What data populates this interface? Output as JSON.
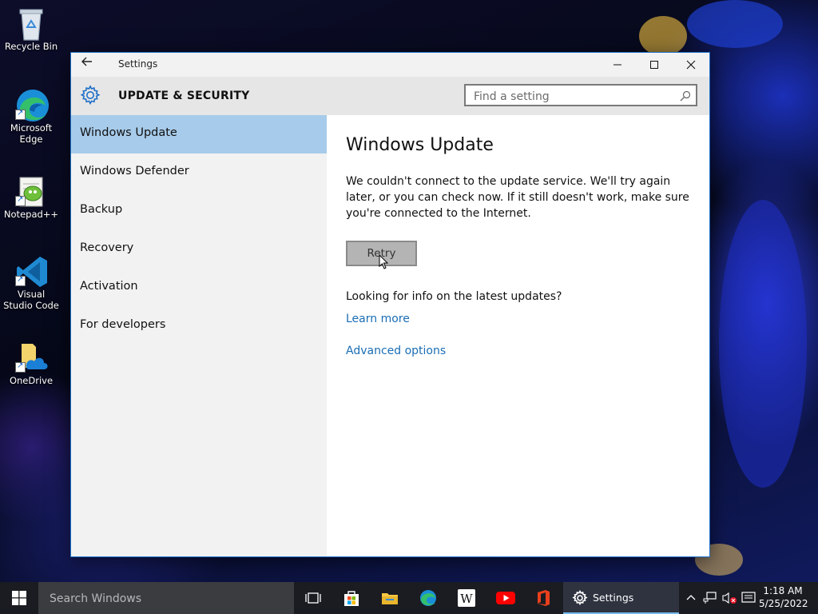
{
  "desktop": {
    "icons": [
      {
        "label": "Recycle Bin"
      },
      {
        "label": "Microsoft Edge"
      },
      {
        "label": "Notepad++"
      },
      {
        "label": "Visual Studio Code"
      },
      {
        "label": "OneDrive"
      }
    ]
  },
  "window": {
    "title": "Settings",
    "back_icon": "back-arrow-icon",
    "controls": [
      "minimize",
      "maximize",
      "close"
    ]
  },
  "header": {
    "title": "UPDATE & SECURITY",
    "search_placeholder": "Find a setting"
  },
  "sidebar": {
    "items": [
      {
        "label": "Windows Update",
        "active": true
      },
      {
        "label": "Windows Defender",
        "active": false
      },
      {
        "label": "Backup",
        "active": false
      },
      {
        "label": "Recovery",
        "active": false
      },
      {
        "label": "Activation",
        "active": false
      },
      {
        "label": "For developers",
        "active": false
      }
    ]
  },
  "main": {
    "title": "Windows Update",
    "message": "We couldn't connect to the update service. We'll try again later, or you can check now. If it still doesn't work, make sure you're connected to the Internet.",
    "retry_label": "Retry",
    "info_question": "Looking for info on the latest updates?",
    "learn_more": "Learn more",
    "advanced_options": "Advanced options"
  },
  "taskbar": {
    "search_placeholder": "Search Windows",
    "active_app": "Settings",
    "pinned": [
      "task-view",
      "microsoft-store",
      "file-explorer",
      "microsoft-edge",
      "wikipedia",
      "youtube",
      "office",
      "settings"
    ],
    "clock_time": "1:18 AM",
    "clock_date": "5/25/2022"
  },
  "colors": {
    "accent": "#1a6db5",
    "selected_nav": "#a7cbea",
    "window_border": "#1e6fc8"
  }
}
